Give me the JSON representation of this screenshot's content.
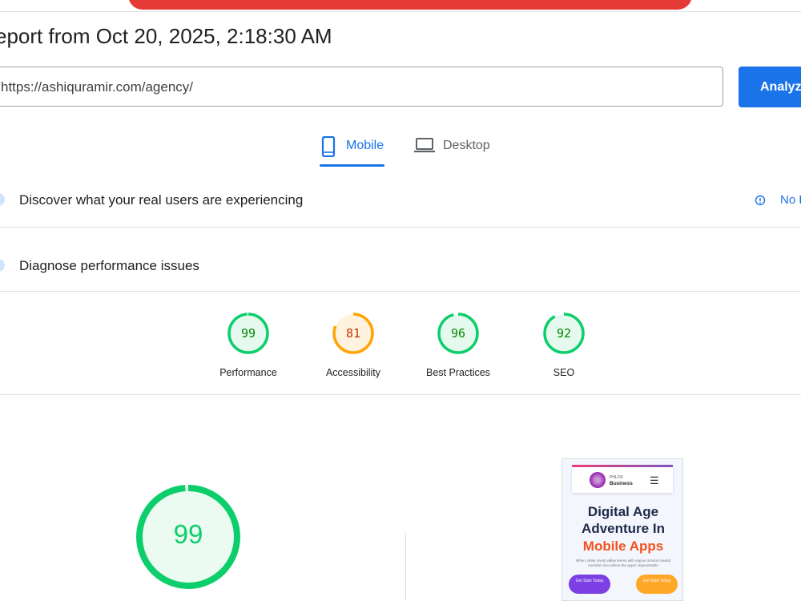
{
  "header": {
    "title": "eport from Oct 20, 2025, 2:18:30 AM"
  },
  "url_input": {
    "value": "https://ashiquramir.com/agency/"
  },
  "analyze_button": {
    "label": "Analyze"
  },
  "tabs": [
    {
      "label": "Mobile",
      "icon": "smartphone-icon",
      "selected": true
    },
    {
      "label": "Desktop",
      "icon": "laptop-icon",
      "selected": false
    }
  ],
  "sections": {
    "real_users": {
      "label": "Discover what your real users are experiencing",
      "no_data": "No Data"
    },
    "diagnose": {
      "label": "Diagnose performance issues"
    }
  },
  "scores": [
    {
      "value": 99,
      "label": "Performance",
      "color": "#0cce6b"
    },
    {
      "value": 81,
      "label": "Accessibility",
      "color": "#ffa400"
    },
    {
      "value": 96,
      "label": "Best Practices",
      "color": "#0cce6b"
    },
    {
      "value": 92,
      "label": "SEO",
      "color": "#0cce6b"
    }
  ],
  "main_score": {
    "value": 99,
    "color": "#0cce6b"
  },
  "screenshot": {
    "brand_top": "PHLOX",
    "brand_bottom": "Business",
    "headline_1": "Digital Age",
    "headline_2": "Adventure In",
    "headline_3": "Mobile Apps",
    "paragraph": "When, while lovely valley teems with vapour around meand meridian sun strikes the upper impenetrable",
    "button_1": "Get Start Today",
    "button_2": "Get Start Today"
  },
  "colors": {
    "accent": "#1a73e8",
    "pass": "#0cce6b",
    "average": "#ffa400",
    "banner": "#e53935"
  }
}
